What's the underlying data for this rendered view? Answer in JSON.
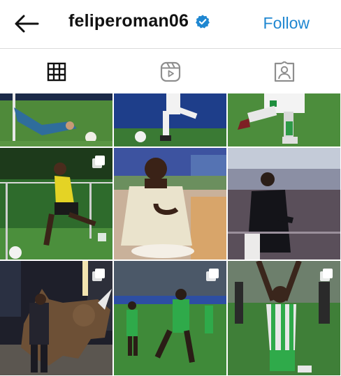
{
  "header": {
    "username": "feliperoman06",
    "follow_label": "Follow",
    "back_icon": "arrow-left-icon",
    "verified_icon": "verified-badge-icon",
    "accent_color": "#1f87d1"
  },
  "tabs": [
    {
      "name": "grid",
      "icon": "grid-icon",
      "active": true
    },
    {
      "name": "reels",
      "icon": "reels-icon",
      "active": false
    },
    {
      "name": "tagged",
      "icon": "tagged-person-icon",
      "active": false
    }
  ],
  "posts": [
    {
      "subject": "goalkeeper diving on pitch",
      "multi": false
    },
    {
      "subject": "player kicking ball on pitch",
      "multi": false
    },
    {
      "subject": "player legs in green socks",
      "multi": false
    },
    {
      "subject": "player jogging with ball on training pitch",
      "multi": true
    },
    {
      "subject": "smiling man at dinner table",
      "multi": false
    },
    {
      "subject": "man in stadium stands pointing",
      "multi": false
    },
    {
      "subject": "man next to bronze bull statue at night",
      "multi": true
    },
    {
      "subject": "team celebrating on field",
      "multi": true
    },
    {
      "subject": "player raising arms in celebration",
      "multi": true
    }
  ]
}
